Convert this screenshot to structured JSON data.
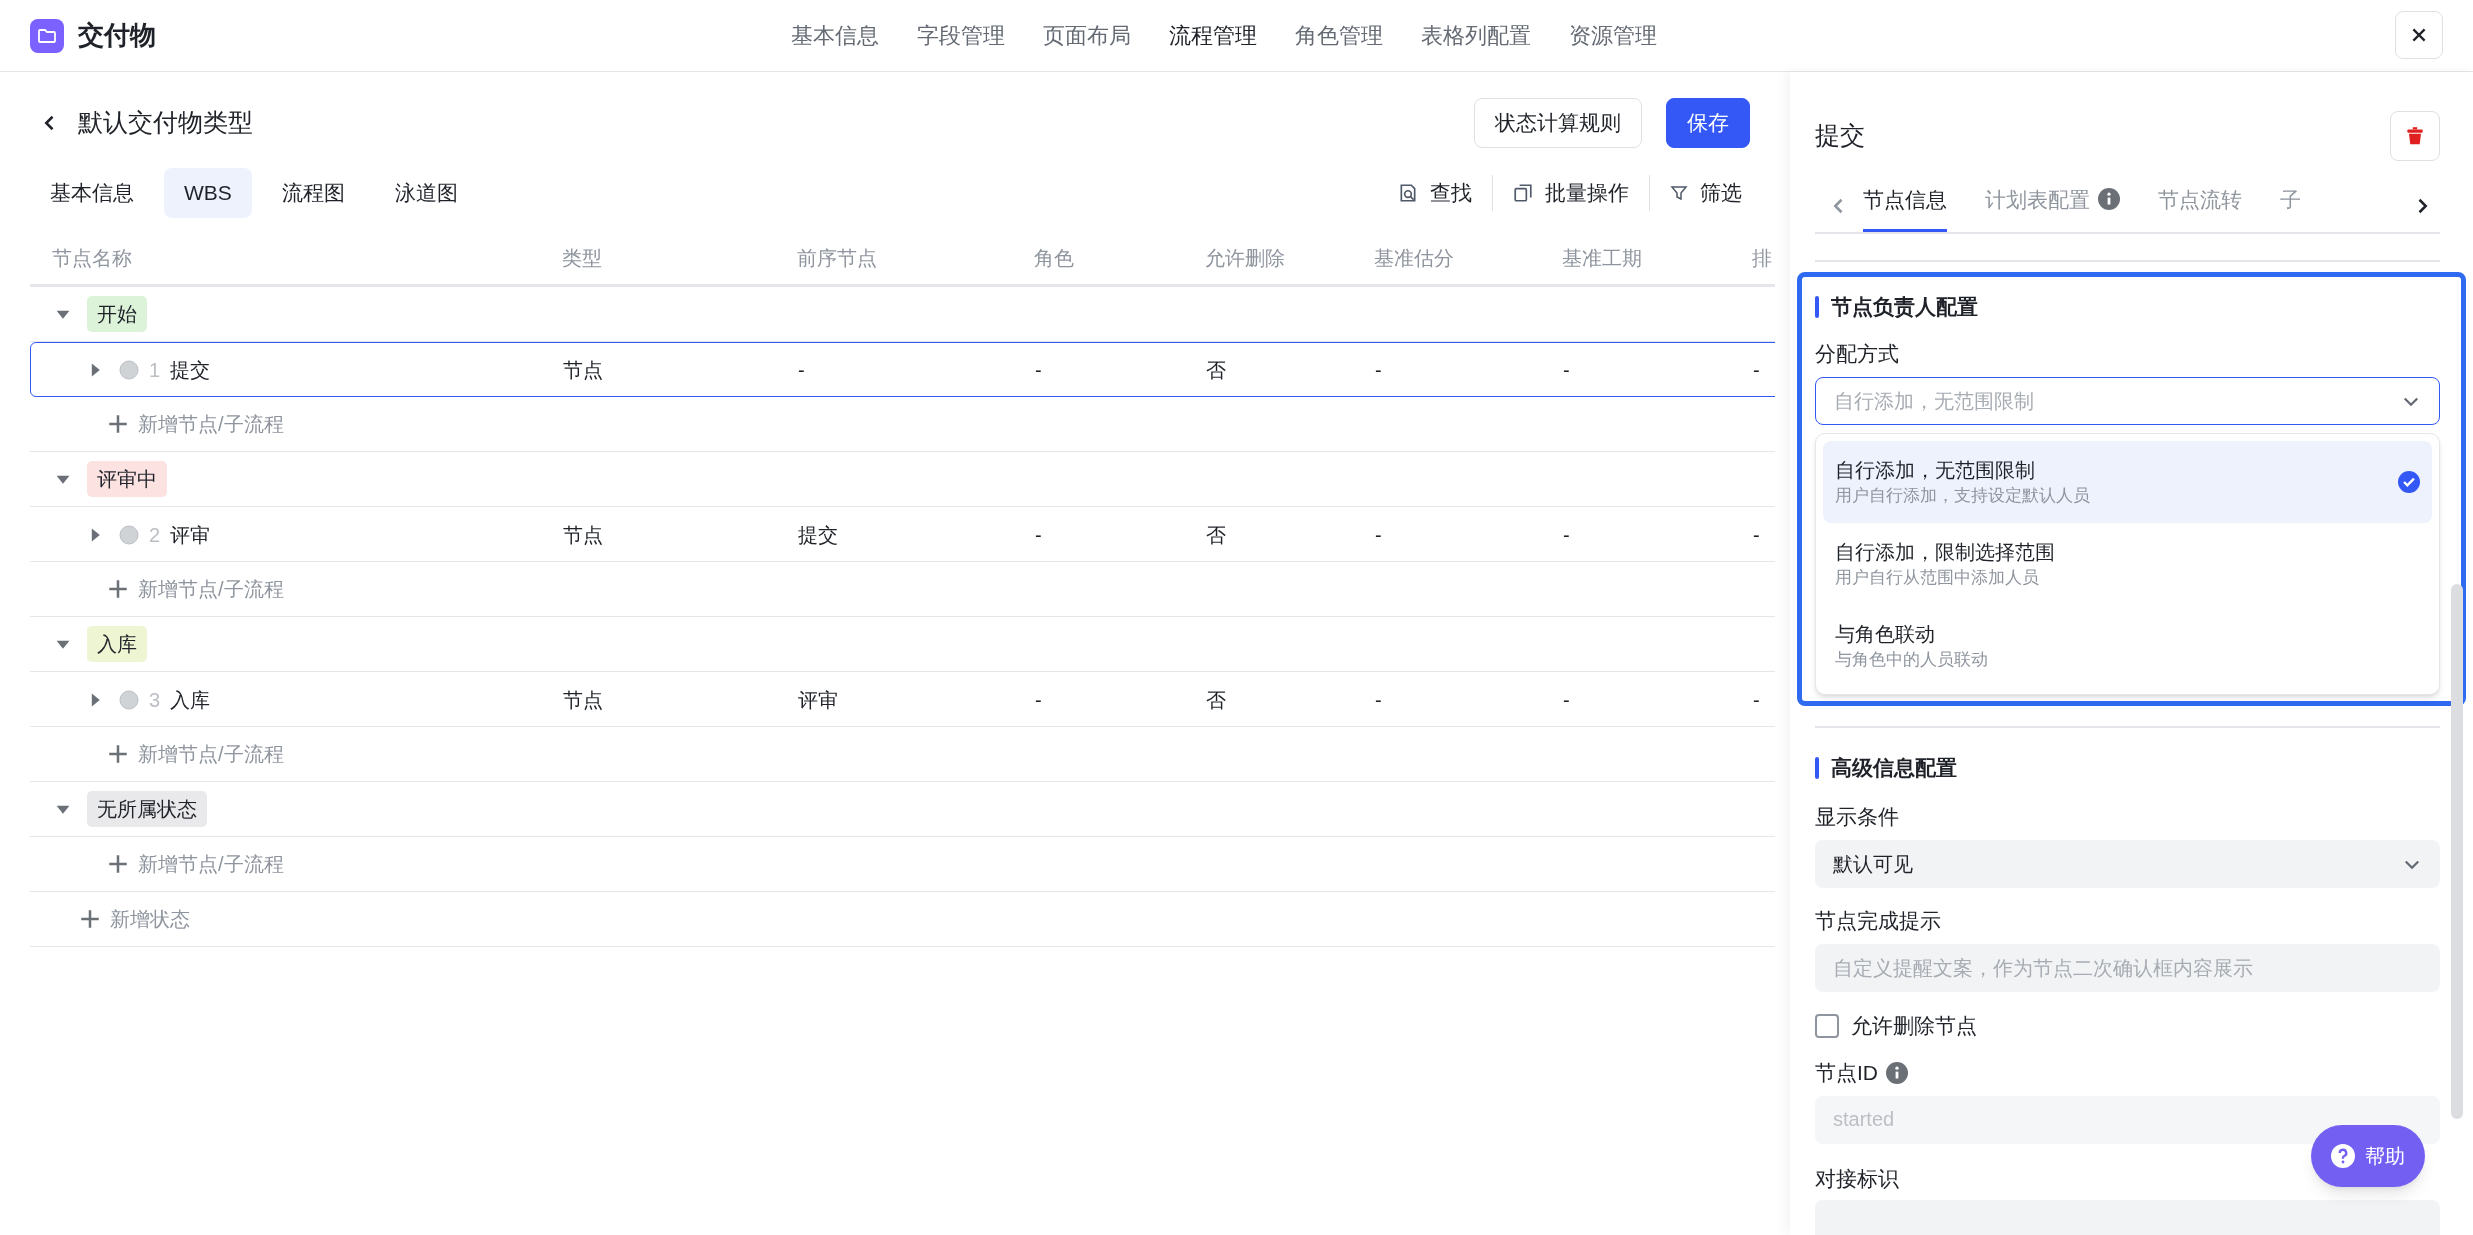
{
  "app": {
    "title": "交付物",
    "nav": [
      {
        "label": "基本信息",
        "selected": false
      },
      {
        "label": "字段管理",
        "selected": false
      },
      {
        "label": "页面布局",
        "selected": false
      },
      {
        "label": "流程管理",
        "selected": true
      },
      {
        "label": "角色管理",
        "selected": false
      },
      {
        "label": "表格列配置",
        "selected": false
      },
      {
        "label": "资源管理",
        "selected": false
      }
    ]
  },
  "page": {
    "title": "默认交付物类型",
    "buttons": [
      {
        "label": "状态计算规则",
        "kind": "secondary"
      },
      {
        "label": "保存",
        "kind": "primary"
      }
    ],
    "view_tabs": [
      {
        "label": "基本信息",
        "selected": false
      },
      {
        "label": "WBS",
        "selected": true
      },
      {
        "label": "流程图",
        "selected": false
      },
      {
        "label": "泳道图",
        "selected": false
      }
    ],
    "tools": [
      {
        "label": "查找",
        "kind": "search"
      },
      {
        "label": "批量操作",
        "kind": "batch"
      },
      {
        "label": "筛选",
        "kind": "filter"
      }
    ],
    "columns": [
      "节点名称",
      "类型",
      "前序节点",
      "角色",
      "允许删除",
      "基准估分",
      "基准工期",
      "排"
    ],
    "groups": [
      {
        "label": "开始",
        "color": "#dcf3d9",
        "expanded": true,
        "add_label": "新增节点/子流程",
        "rows": [
          {
            "index": "1",
            "name": "提交",
            "expanded": false,
            "selected": true,
            "cells": [
              "节点",
              "-",
              "-",
              "否",
              "-",
              "-",
              "-"
            ]
          }
        ]
      },
      {
        "label": "评审中",
        "color": "#fde2e2",
        "expanded": true,
        "add_label": "新增节点/子流程",
        "rows": [
          {
            "index": "2",
            "name": "评审",
            "expanded": false,
            "selected": false,
            "cells": [
              "节点",
              "提交",
              "-",
              "否",
              "-",
              "-",
              "-"
            ]
          }
        ]
      },
      {
        "label": "入库",
        "color": "#eef5d2",
        "expanded": true,
        "add_label": "新增节点/子流程",
        "rows": [
          {
            "index": "3",
            "name": "入库",
            "expanded": false,
            "selected": false,
            "cells": [
              "节点",
              "评审",
              "-",
              "否",
              "-",
              "-",
              "-"
            ]
          }
        ]
      },
      {
        "label": "无所属状态",
        "color": "#e9e9eb",
        "expanded": true,
        "add_label": "新增节点/子流程"
      }
    ],
    "add_state": "新增状态"
  },
  "panel": {
    "title": "提交",
    "tabs": [
      {
        "label": "节点信息",
        "selected": true,
        "info": false
      },
      {
        "label": "计划表配置",
        "selected": false,
        "info": true
      },
      {
        "label": "节点流转",
        "selected": false,
        "info": false
      },
      {
        "label": "子",
        "selected": false,
        "info": false
      }
    ],
    "owner": {
      "heading": "节点负责人配置",
      "field_label": "分配方式",
      "placeholder": "自行添加，无范围限制",
      "options": [
        {
          "title": "自行添加，无范围限制",
          "desc": "用户自行添加，支持设定默认人员",
          "selected": true
        },
        {
          "title": "自行添加，限制选择范围",
          "desc": "用户自行从范围中添加人员",
          "selected": false
        },
        {
          "title": "与角色联动",
          "desc": "与角色中的人员联动",
          "selected": false
        }
      ]
    },
    "advanced": {
      "heading": "高级信息配置",
      "display_label": "显示条件",
      "display_value": "默认可见",
      "hint_label": "节点完成提示",
      "hint_placeholder": "自定义提醒文案，作为节点二次确认框内容展示",
      "allow_delete": {
        "label": "允许删除节点",
        "checked": false
      },
      "id_label": "节点ID",
      "id_placeholder": "started",
      "code_label": "对接标识"
    },
    "help": "帮助"
  }
}
